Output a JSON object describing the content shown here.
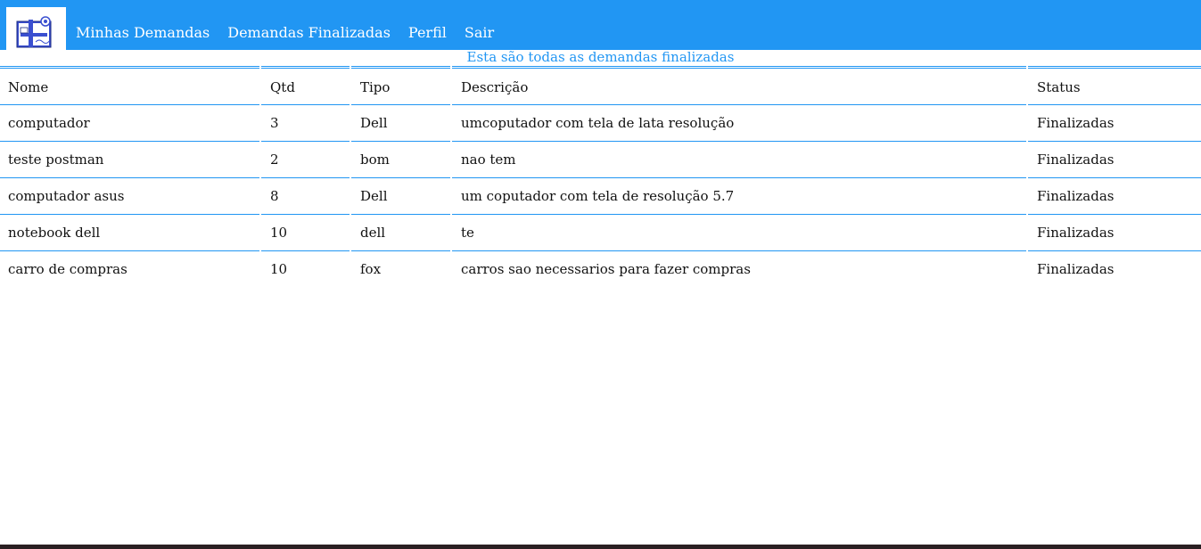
{
  "nav": {
    "items": [
      {
        "label": "Minhas Demandas"
      },
      {
        "label": "Demandas Finalizadas"
      },
      {
        "label": "Perfil"
      },
      {
        "label": "Sair"
      }
    ],
    "color": "#2196f3"
  },
  "subtitle": "Esta são todas as demandas finalizadas",
  "table": {
    "headers": [
      "Nome",
      "Qtd",
      "Tipo",
      "Descrição",
      "Status"
    ],
    "rows": [
      [
        "computador",
        "3",
        "Dell",
        "umcoputador com tela de lata resolução",
        "Finalizadas"
      ],
      [
        "teste postman",
        "2",
        "bom",
        "nao tem",
        "Finalizadas"
      ],
      [
        "computador asus",
        "8",
        "Dell",
        "um coputador com tela de resolução 5.7",
        "Finalizadas"
      ],
      [
        "notebook dell",
        "10",
        "dell",
        "te",
        "Finalizadas"
      ],
      [
        "carro de compras",
        "10",
        "fox",
        "carros sao necessarios para fazer compras",
        "Finalizadas"
      ]
    ]
  }
}
